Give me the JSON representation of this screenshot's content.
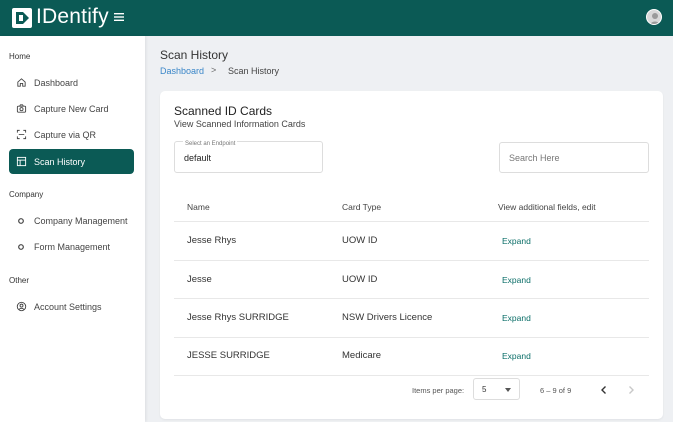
{
  "app": {
    "title": "IDentify"
  },
  "sidebar": {
    "sections": [
      {
        "label": "Home"
      },
      {
        "label": "Company"
      },
      {
        "label": "Other"
      }
    ],
    "items": [
      {
        "label": "Dashboard",
        "icon": "home-icon"
      },
      {
        "label": "Capture New Card",
        "icon": "camera-icon"
      },
      {
        "label": "Capture via QR",
        "icon": "qr-scan-icon"
      },
      {
        "label": "Scan History",
        "icon": "table-icon",
        "active": true
      },
      {
        "label": "Company Management",
        "icon": "circle-icon"
      },
      {
        "label": "Form Management",
        "icon": "circle-icon"
      },
      {
        "label": "Account Settings",
        "icon": "account-circle-icon"
      }
    ]
  },
  "page": {
    "title": "Scan History",
    "breadcrumb": {
      "link": "Dashboard",
      "separator": ">",
      "current": "Scan History"
    }
  },
  "card": {
    "title": "Scanned ID Cards",
    "subtitle": "View Scanned Information Cards",
    "endpoint": {
      "label": "Select an Endpoint",
      "value": "default"
    },
    "search": {
      "placeholder": "Search Here"
    },
    "table": {
      "headers": [
        "Name",
        "Card Type",
        "View additional fields, edit"
      ],
      "rows": [
        {
          "name": "Jesse Rhys",
          "card_type": "UOW ID",
          "action": "Expand"
        },
        {
          "name": "Jesse",
          "card_type": "UOW ID",
          "action": "Expand"
        },
        {
          "name": "Jesse Rhys SURRIDGE",
          "card_type": "NSW Drivers Licence",
          "action": "Expand"
        },
        {
          "name": "JESSE SURRIDGE",
          "card_type": "Medicare",
          "action": "Expand"
        }
      ]
    },
    "pagination": {
      "items_per_page_label": "Items per page:",
      "items_per_page": "5",
      "range": "6 – 9 of 9"
    }
  },
  "colors": {
    "brand": "#0b5a55",
    "link": "#3a86c8",
    "expand": "#0b6e68"
  }
}
